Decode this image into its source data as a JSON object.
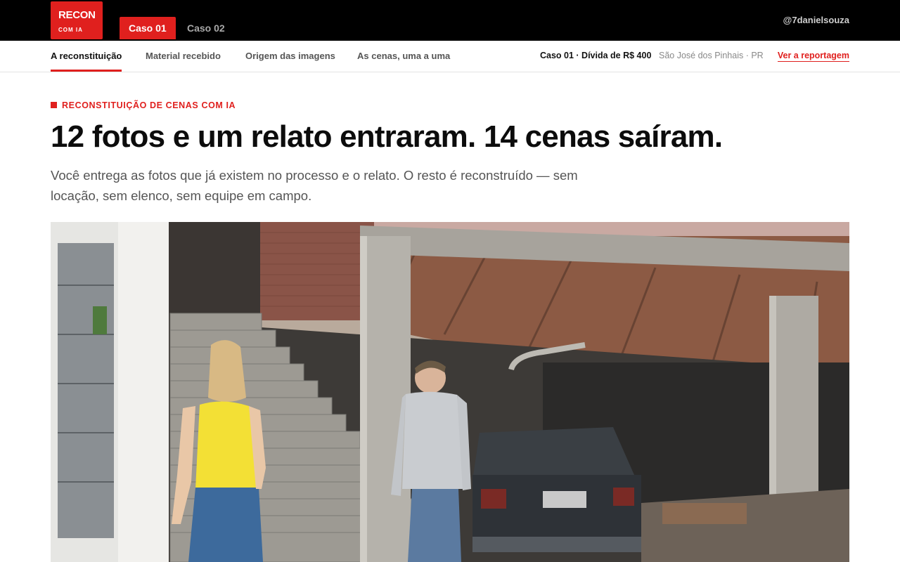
{
  "brand": {
    "name": "RECON",
    "sub": "COM IA",
    "color": "#e0201e"
  },
  "cases": [
    {
      "label": "Caso 01",
      "active": true
    },
    {
      "label": "Caso 02",
      "active": false
    }
  ],
  "user": {
    "handle": "@7danielsouza"
  },
  "nav": {
    "items": [
      {
        "label": "A reconstituição",
        "active": true
      },
      {
        "label": "Material recebido",
        "active": false
      },
      {
        "label": "Origem das imagens",
        "active": false
      },
      {
        "label": "As cenas, uma a uma",
        "active": false
      }
    ],
    "case_info": "Caso 01 · Dívida de R$ 400",
    "location": "São José dos Pinhais · PR",
    "report_link": "Ver a reportagem"
  },
  "hero": {
    "eyebrow": "RECONSTITUIÇÃO DE CENAS COM IA",
    "headline": "12 fotos e um relato entraram. 14 cenas saíram.",
    "lede": "Você entrega as fotos que já existem no processo e o relato. O resto é reconstruído — sem locação, sem elenco, sem equipe em campo."
  },
  "image": {
    "description_icon": "scene-photo",
    "subject": "reconstructed-scene"
  }
}
